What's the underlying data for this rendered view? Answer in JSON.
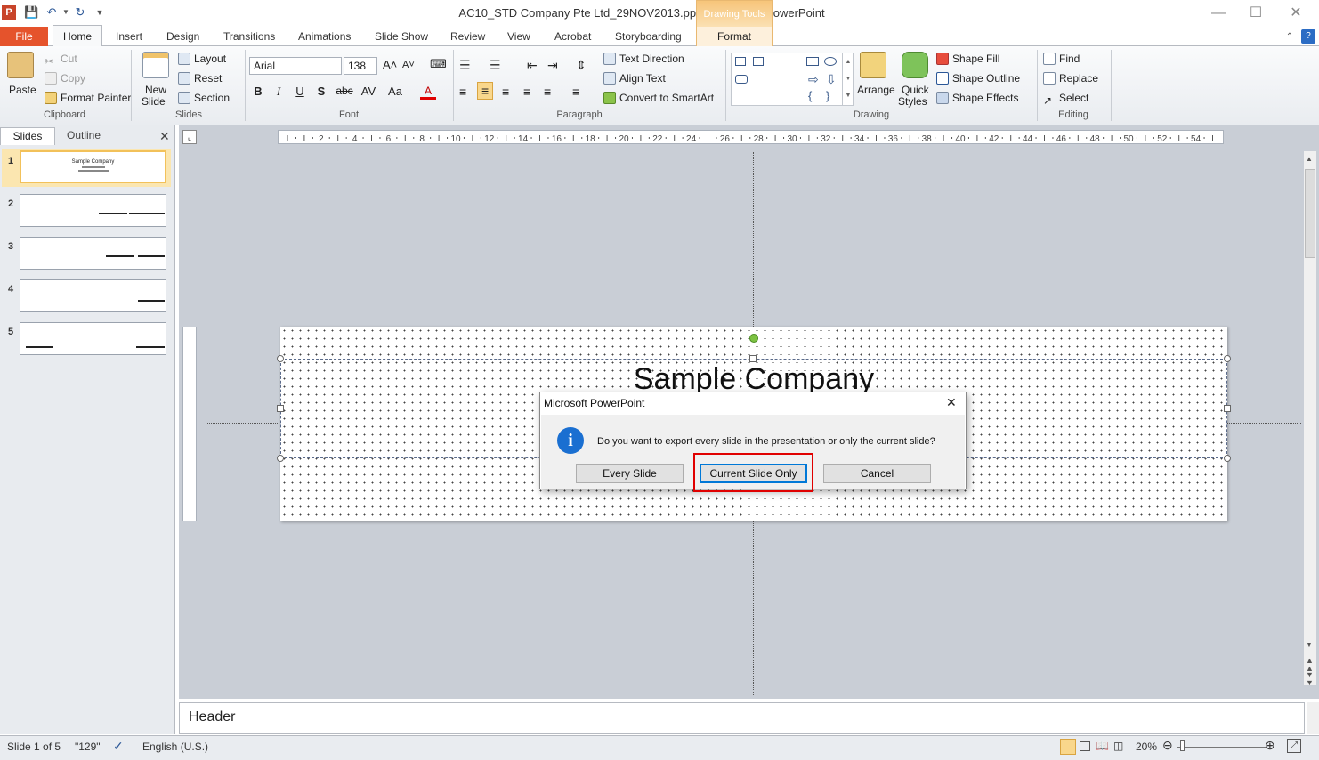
{
  "window": {
    "title": "AC10_STD Company Pte Ltd_29NOV2013.pptx  -  Microsoft PowerPoint",
    "contextual_tab_group": "Drawing Tools"
  },
  "tabs": [
    "File",
    "Home",
    "Insert",
    "Design",
    "Transitions",
    "Animations",
    "Slide Show",
    "Review",
    "View",
    "Acrobat",
    "Storyboarding",
    "Format"
  ],
  "ribbon": {
    "clipboard": {
      "paste": "Paste",
      "cut": "Cut",
      "copy": "Copy",
      "format_painter": "Format Painter",
      "label": "Clipboard"
    },
    "slides": {
      "new_slide_1": "New",
      "new_slide_2": "Slide",
      "layout": "Layout",
      "reset": "Reset",
      "section": "Section",
      "label": "Slides"
    },
    "font": {
      "name": "Arial",
      "size": "138",
      "label": "Font"
    },
    "paragraph": {
      "text_direction": "Text Direction",
      "align_text": "Align Text",
      "convert_smartart": "Convert to SmartArt",
      "label": "Paragraph"
    },
    "drawing": {
      "arrange": "Arrange",
      "quick_styles_1": "Quick",
      "quick_styles_2": "Styles",
      "shape_fill": "Shape Fill",
      "shape_outline": "Shape Outline",
      "shape_effects": "Shape Effects",
      "label": "Drawing"
    },
    "editing": {
      "find": "Find",
      "replace": "Replace",
      "select": "Select",
      "label": "Editing"
    }
  },
  "pane": {
    "slides_tab": "Slides",
    "outline_tab": "Outline",
    "thumbs": [
      "1",
      "2",
      "3",
      "4",
      "5"
    ],
    "thumb1_title": "Sample  Company"
  },
  "ruler": {
    "ticks": [
      "2",
      "4",
      "6",
      "8",
      "10",
      "12",
      "14",
      "16",
      "18",
      "20",
      "22",
      "24",
      "26",
      "28",
      "30",
      "32",
      "34",
      "36",
      "38",
      "40",
      "42",
      "44",
      "46",
      "48",
      "50",
      "52",
      "54"
    ]
  },
  "slide": {
    "title": "Sample Company"
  },
  "notes": {
    "text": "Header"
  },
  "dialog": {
    "title": "Microsoft PowerPoint",
    "message": "Do you want to export every slide in the presentation or only the current slide?",
    "every_slide": "Every Slide",
    "current_slide_only": "Current Slide Only",
    "cancel": "Cancel"
  },
  "status": {
    "slide": "Slide 1 of 5",
    "theme": "\"129\"",
    "language": "English (U.S.)",
    "zoom": "20%"
  },
  "colors": {
    "file_tab": "#e5532c",
    "highlight": "#e00000",
    "thumb_selected": "#f2c15a",
    "dialog_info": "#1a6fd1"
  }
}
